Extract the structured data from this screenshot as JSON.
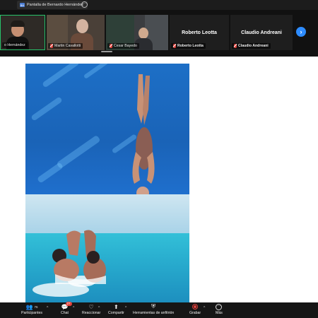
{
  "topbar": {
    "share_label": "Pantalla de Bernardo Hernández",
    "share_icon": "screen-share-icon",
    "more_icon": "more-icon"
  },
  "gallery": {
    "tiles": [
      {
        "name": "o Hernández",
        "muted": false
      },
      {
        "name": "Martin Cavallotti",
        "muted": true
      },
      {
        "name": "Cesar Bayedo",
        "muted": true
      },
      {
        "name": "Roberto Leotta",
        "muted": true,
        "header": "Roberto Leotta"
      },
      {
        "name": "Claudio Andreani",
        "muted": true,
        "header": "Claudio Andreani"
      }
    ],
    "next_label": "›",
    "colors": {
      "active_border": "#27c26a",
      "next_button": "#2d8cff",
      "mic_off": "#e0403b"
    }
  },
  "toolbar": {
    "participants": {
      "label": "Participantes",
      "count": "76"
    },
    "chat": {
      "label": "Chat",
      "badge": "27"
    },
    "reactions": {
      "label": "Reaccionar"
    },
    "share": {
      "label": "Compartir"
    },
    "host_tools": {
      "label": "Herramientas de anfitrión"
    },
    "record": {
      "label": "Grabar"
    },
    "more": {
      "label": "Más"
    }
  }
}
